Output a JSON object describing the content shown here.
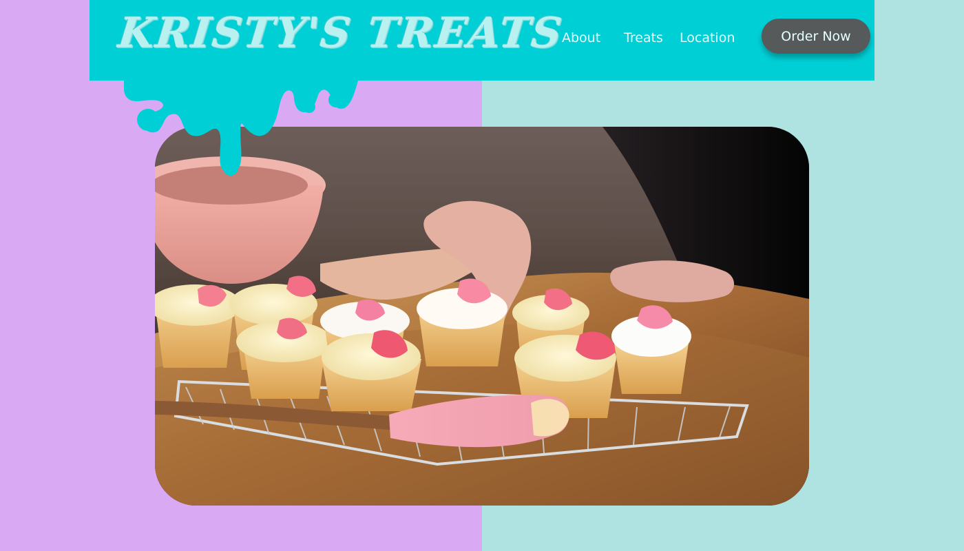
{
  "brand": {
    "name": "KRISTY'S TREATS"
  },
  "nav": {
    "items": [
      {
        "label": "About"
      },
      {
        "label": "Treats"
      },
      {
        "label": "Location"
      }
    ],
    "cta_label": "Order Now"
  },
  "hero": {
    "image_subject": "cupcakes-on-cooling-rack"
  },
  "colors": {
    "header_bg": "#00d0d6",
    "left_panel": "#d9a9f3",
    "right_panel": "#aee3e2",
    "cta_bg": "#575a5a",
    "cta_text": "#e7ffff"
  }
}
